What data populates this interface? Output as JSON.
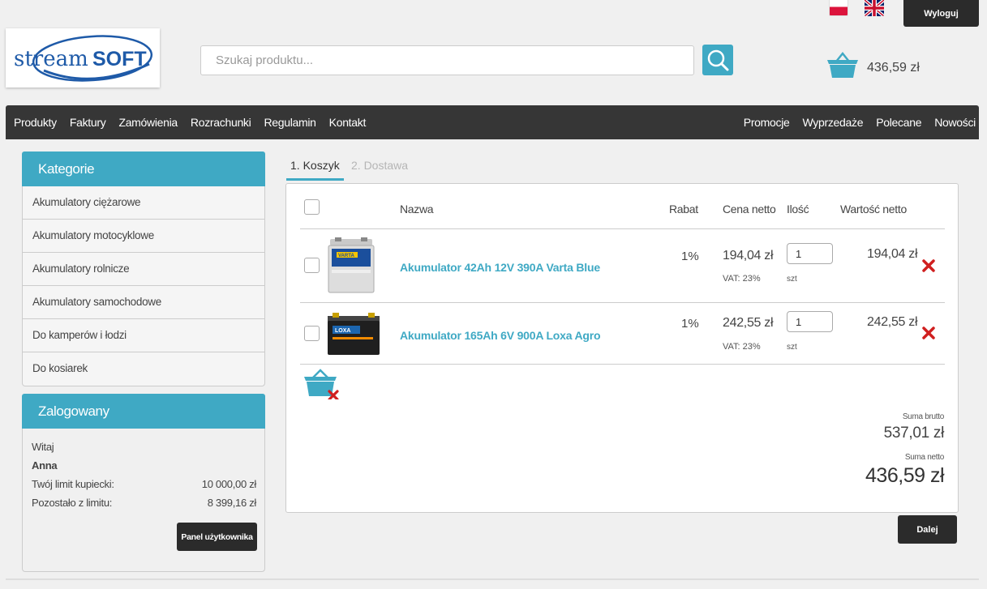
{
  "header": {
    "logout_label": "Wyloguj",
    "logo_text_light": "stream",
    "logo_text_bold": "SOFT",
    "search_placeholder": "Szukaj produktu...",
    "cart_total": "436,59 zł"
  },
  "nav": {
    "left": [
      "Produkty",
      "Faktury",
      "Zamówienia",
      "Rozrachunki",
      "Regulamin",
      "Kontakt"
    ],
    "right": [
      "Promocje",
      "Wyprzedaże",
      "Polecane",
      "Nowości"
    ]
  },
  "categories": {
    "title": "Kategorie",
    "items": [
      "Akumulatory ciężarowe",
      "Akumulatory motocyklowe",
      "Akumulatory rolnicze",
      "Akumulatory samochodowe",
      "Do kamperów i łodzi",
      "Do kosiarek"
    ]
  },
  "login": {
    "title": "Zalogowany",
    "greeting": "Witaj",
    "name": "Anna",
    "limit_label": "Twój limit kupiecki:",
    "limit_value": "10 000,00 zł",
    "remaining_label": "Pozostało z limitu:",
    "remaining_value": "8 399,16 zł",
    "panel_button": "Panel użytkownika"
  },
  "tabs": [
    "1. Koszyk",
    "2. Dostawa"
  ],
  "cart": {
    "headers": {
      "name": "Nazwa",
      "rabat": "Rabat",
      "price": "Cena netto",
      "qty": "Ilość",
      "value": "Wartość netto"
    },
    "items": [
      {
        "name": "Akumulator 42Ah 12V 390A Varta Blue",
        "brand": "VARTA",
        "rabat": "1%",
        "price": "194,04 zł",
        "vat": "VAT: 23%",
        "qty": "1",
        "unit": "szt",
        "value": "194,04 zł"
      },
      {
        "name": "Akumulator 165Ah 6V 900A Loxa Agro",
        "brand": "LOXA",
        "rabat": "1%",
        "price": "242,55 zł",
        "vat": "VAT: 23%",
        "qty": "1",
        "unit": "szt",
        "value": "242,55 zł"
      }
    ],
    "sum_brutto_label": "Suma brutto",
    "sum_brutto": "537,01 zł",
    "sum_netto_label": "Suma netto",
    "sum_netto": "436,59 zł",
    "next_button": "Dalej"
  },
  "colors": {
    "accent": "#3fa9c4",
    "dark": "#363636",
    "remove": "#d01f1f"
  }
}
